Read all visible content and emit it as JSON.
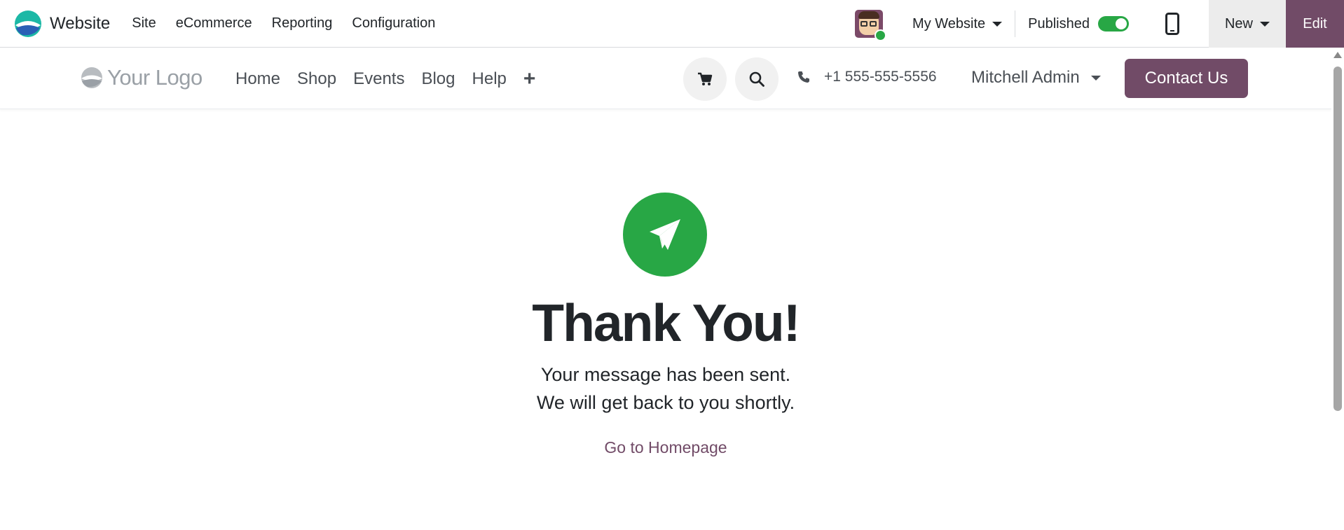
{
  "topbar": {
    "app_name": "Website",
    "menu": [
      "Site",
      "eCommerce",
      "Reporting",
      "Configuration"
    ],
    "website_selector": "My Website",
    "published_label": "Published",
    "published": true,
    "new_label": "New",
    "edit_label": "Edit"
  },
  "header": {
    "logo_text": "Your Logo",
    "nav": [
      "Home",
      "Shop",
      "Events",
      "Blog",
      "Help"
    ],
    "add_menu_symbol": "+",
    "phone": "+1 555-555-5556",
    "user_name": "Mitchell Admin",
    "contact_label": "Contact Us"
  },
  "main": {
    "heading": "Thank You!",
    "message_line1": "Your message has been sent.",
    "message_line2": "We will get back to you shortly.",
    "homepage_link": "Go to Homepage"
  },
  "colors": {
    "brand": "#714b67",
    "success": "#28a745"
  }
}
